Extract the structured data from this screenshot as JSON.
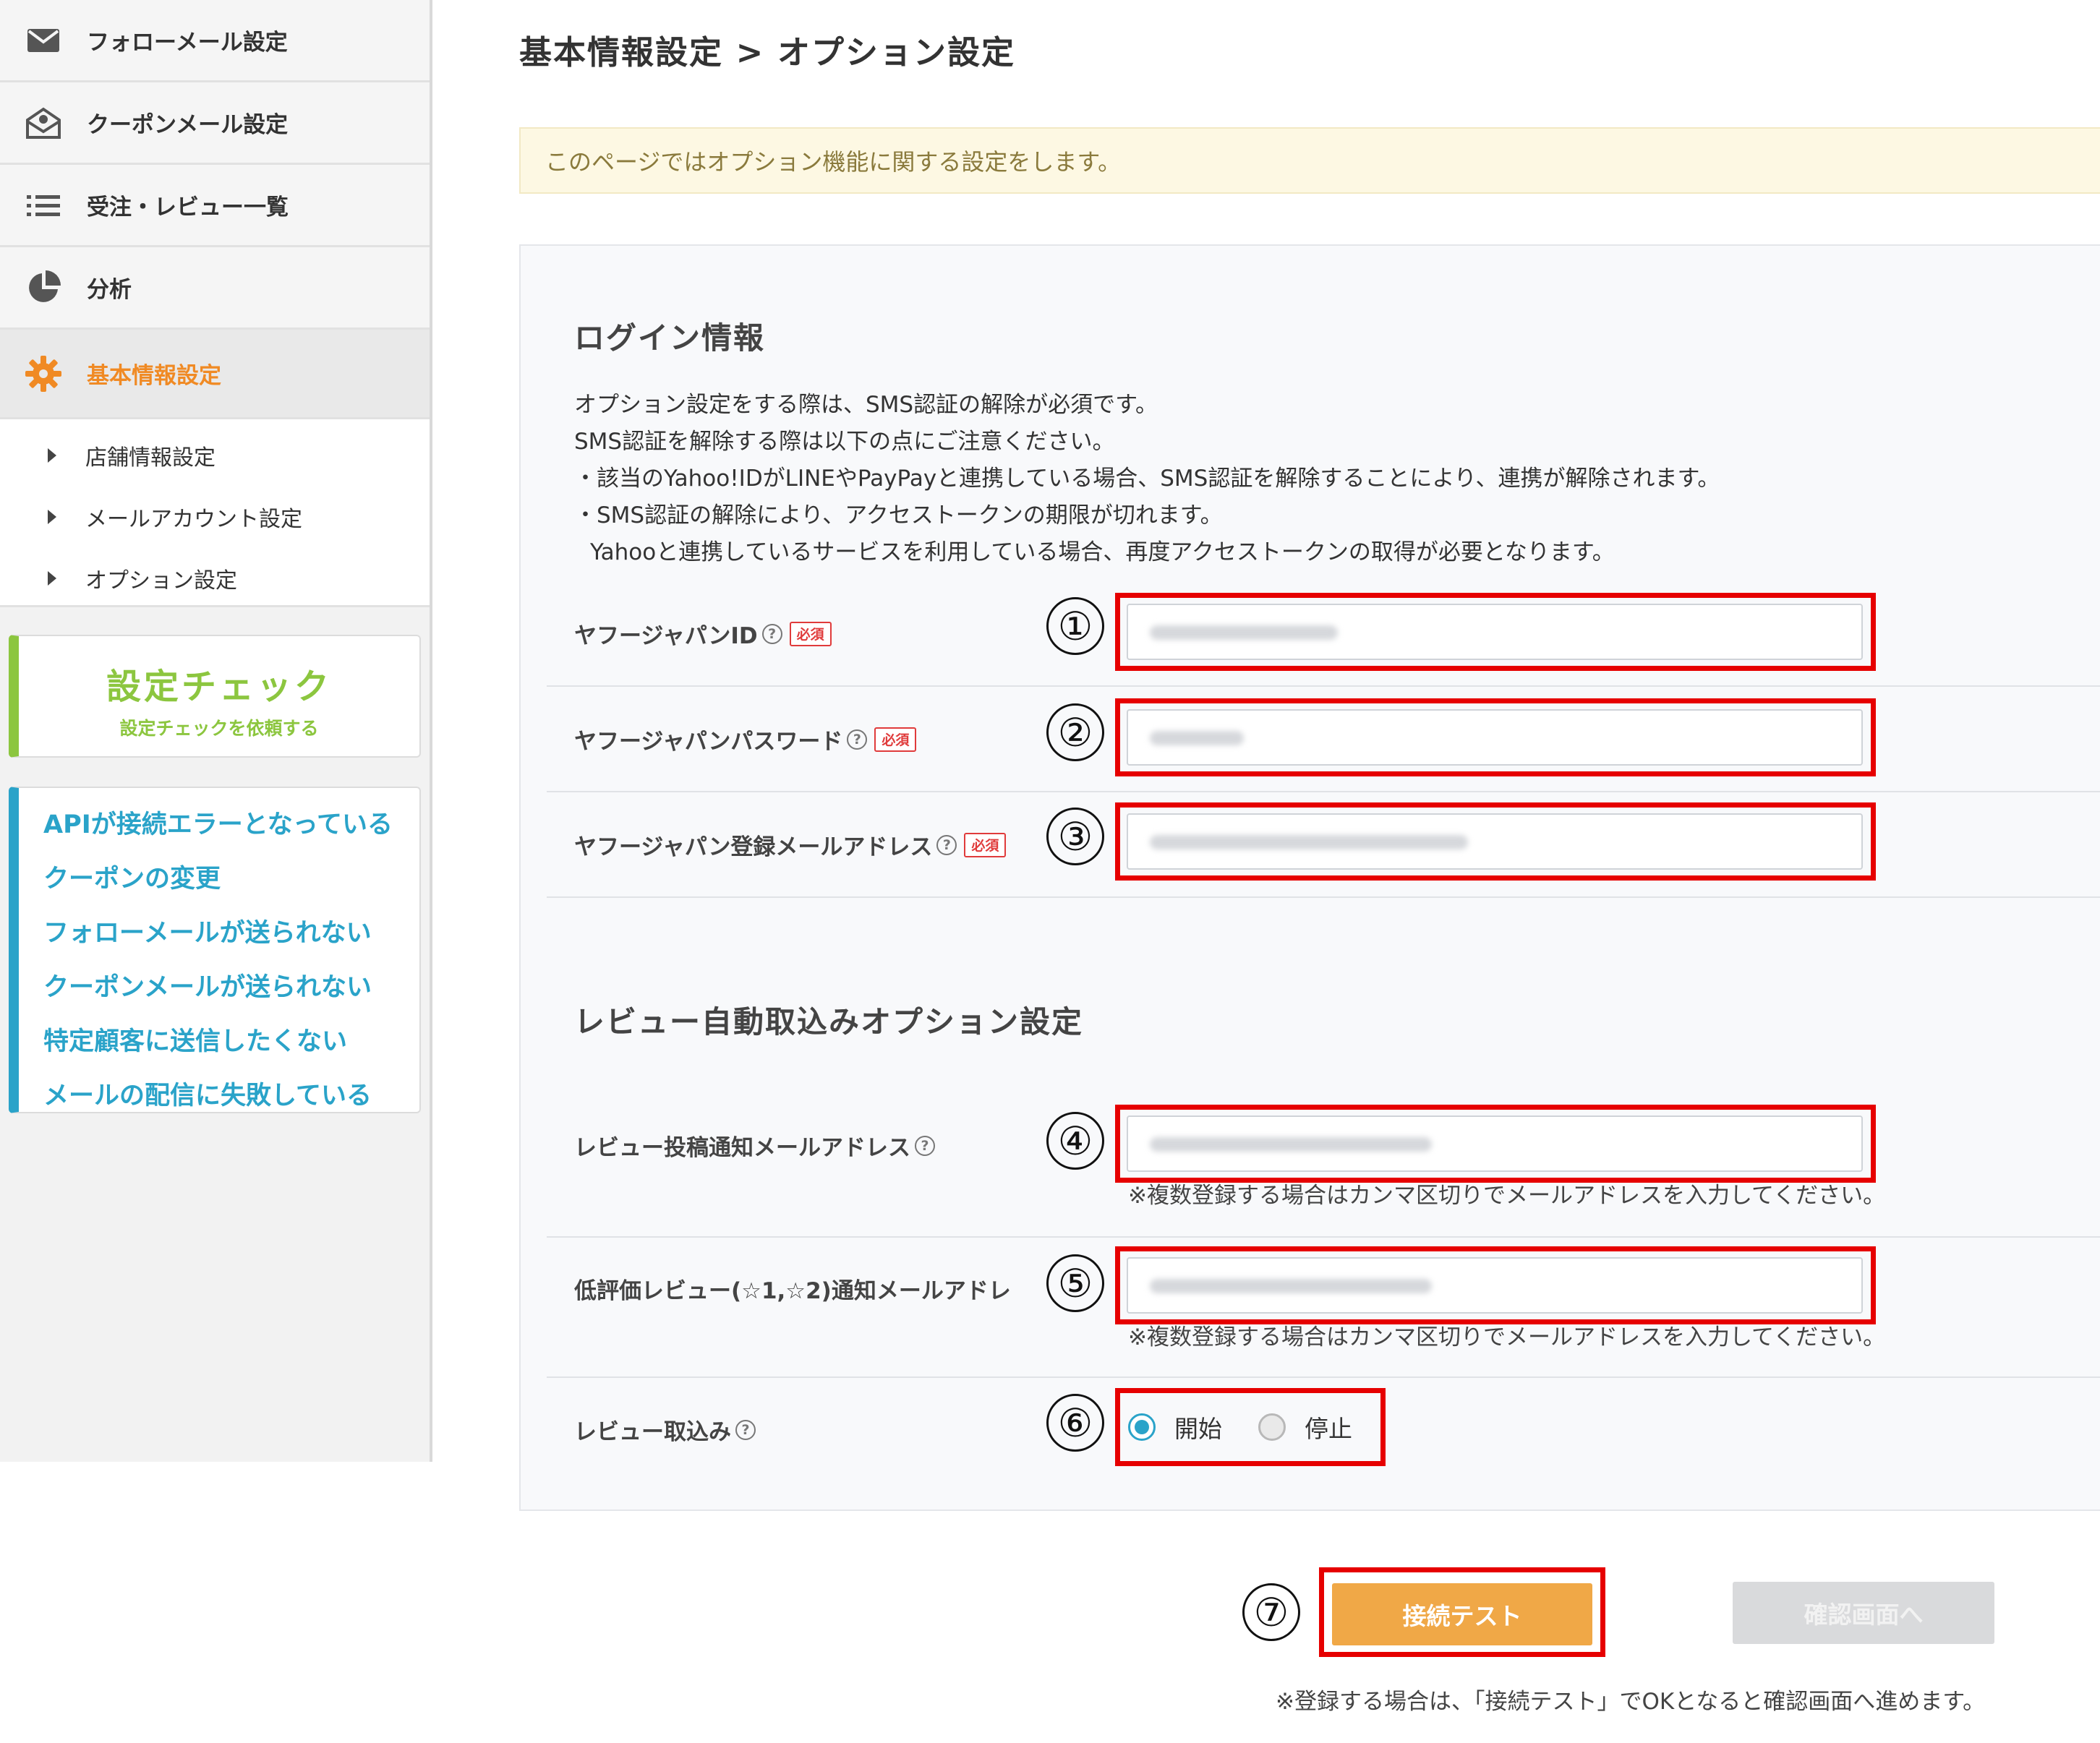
{
  "sidebar": {
    "nav": [
      {
        "label": "フォローメール設定",
        "icon": "mail-icon"
      },
      {
        "label": "クーポンメール設定",
        "icon": "envelope-open-icon"
      },
      {
        "label": "受注・レビュー一覧",
        "icon": "list-icon"
      },
      {
        "label": "分析",
        "icon": "pie-chart-icon"
      },
      {
        "label": "基本情報設定",
        "icon": "gear-icon",
        "active": true
      }
    ],
    "sub_items": [
      "店舗情報設定",
      "メールアカウント設定",
      "オプション設定"
    ],
    "check_card": {
      "title": "設定チェック",
      "subtitle": "設定チェックを依頼する"
    },
    "faq_links": [
      "APIが接続エラーとなっている",
      "クーポンの変更",
      "フォローメールが送られない",
      "クーポンメールが送られない",
      "特定顧客に送信したくない",
      "メールの配信に失敗している"
    ]
  },
  "main": {
    "title": "基本情報設定 > オプション設定",
    "notice": "このページではオプション機能に関する設定をします。",
    "login_section": {
      "title": "ログイン情報",
      "description": [
        "オプション設定をする際は、SMS認証の解除が必須です。",
        "SMS認証を解除する際は以下の点にご注意ください。",
        "・該当のYahoo!IDがLINEやPayPayと連携している場合、SMS認証を解除することにより、連携が解除されます。",
        "・SMS認証の解除により、アクセストークンの期限が切れます。",
        "  Yahooと連携しているサービスを利用している場合、再度アクセストークンの取得が必要となります。"
      ],
      "fields": [
        {
          "label": "ヤフージャパンID",
          "required": "必須",
          "marker": "①"
        },
        {
          "label": "ヤフージャパンパスワード",
          "required": "必須",
          "marker": "②"
        },
        {
          "label": "ヤフージャパン登録メールアドレス",
          "required": "必須",
          "marker": "③"
        }
      ]
    },
    "review_section": {
      "title": "レビュー自動取込みオプション設定",
      "fields": [
        {
          "label": "レビュー投稿通知メールアドレス",
          "marker": "④",
          "hint": "※複数登録する場合はカンマ区切りでメールアドレスを入力してください。"
        },
        {
          "label": "低評価レビュー(☆1,☆2)通知メールアドレ",
          "marker": "⑤",
          "hint": "※複数登録する場合はカンマ区切りでメールアドレスを入力してください。"
        }
      ],
      "import": {
        "label": "レビュー取込み",
        "marker": "⑥",
        "options": [
          "開始",
          "停止"
        ],
        "selected": "開始"
      }
    },
    "actions": {
      "marker": "⑦",
      "test_label": "接続テスト",
      "confirm_label": "確認画面へ",
      "footer_note": "※登録する場合は、「接続テスト」でOKとなると確認画面へ進めます。"
    },
    "help_glyph": "?"
  },
  "colors": {
    "accent_orange": "#f08a24",
    "button_orange": "#f0a847",
    "link_blue": "#2aa3c9",
    "check_green": "#8cc63f",
    "annotation_red": "#e60000",
    "required_red": "#e03b3b"
  }
}
